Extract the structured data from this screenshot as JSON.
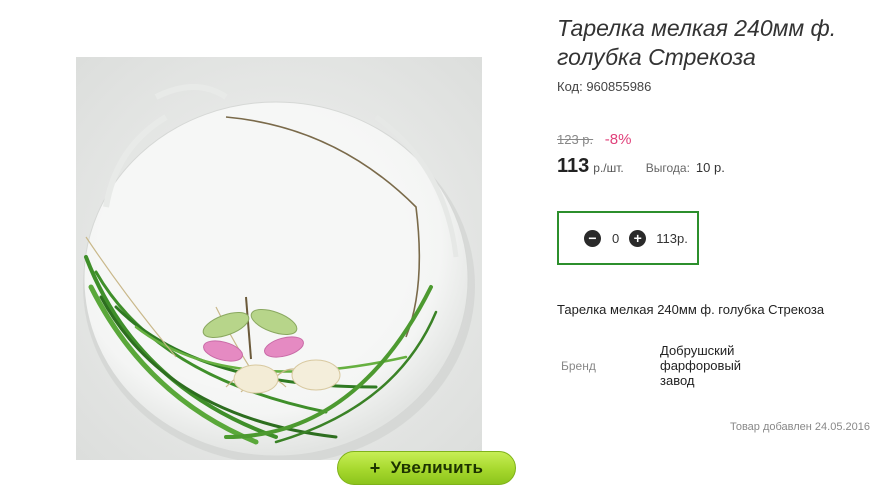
{
  "product": {
    "title": "Тарелка мелкая 240мм ф. голубка Стрекоза",
    "code": "Код: 960855986",
    "image_alt": "plate-photo"
  },
  "pricing": {
    "old_price": "123 р.",
    "discount": "-8%",
    "price": "113",
    "unit": "р./шт.",
    "benefit_label": "Выгода:",
    "benefit_value": "10 р."
  },
  "cart": {
    "quantity": "0",
    "total": "113р."
  },
  "zoom_button": {
    "icon": "+",
    "label": "Увеличить"
  },
  "description": "Тарелка мелкая 240мм ф. голубка Стрекоза",
  "attributes": {
    "brand_label": "Бренд",
    "brand_value": "Добрушский фарфоровый завод"
  },
  "added_date": "Товар добавлен 24.05.2016",
  "colors": {
    "accent_green": "#2c8f2c",
    "zoom_button_green": "#a6d82d",
    "discount_pink": "#e0407a"
  }
}
